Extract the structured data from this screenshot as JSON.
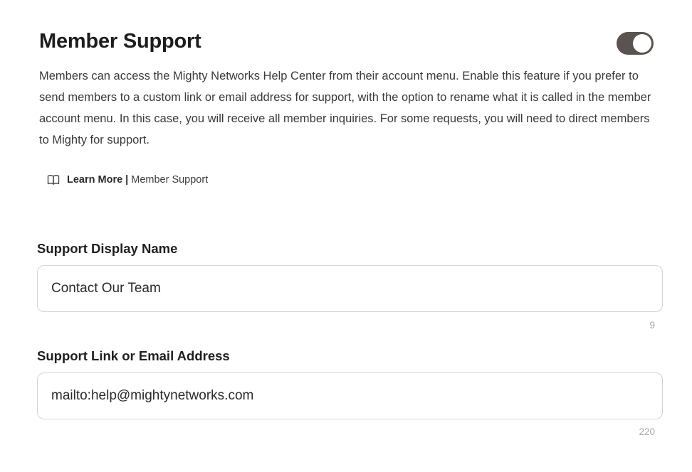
{
  "member_support": {
    "title": "Member Support",
    "toggle_enabled": true,
    "toggle_color": "#5a5350",
    "description": "Members can access the Mighty Networks Help Center from their account menu. Enable this feature if you prefer to send members to a custom link or email address for support, with the option to rename what it is called in the member account menu. In this case, you will receive all member inquiries. For some requests, you will need to direct members to Mighty for support.",
    "learn_more": {
      "icon": "book-icon",
      "label": "Learn More",
      "separator": "|",
      "topic": "Member Support"
    }
  },
  "fields": {
    "display_name": {
      "label": "Support Display Name",
      "value": "Contact Our Team",
      "remaining": "9"
    },
    "link": {
      "label": "Support Link or Email Address",
      "value": "mailto:help@mightynetworks.com",
      "remaining": "220"
    }
  }
}
